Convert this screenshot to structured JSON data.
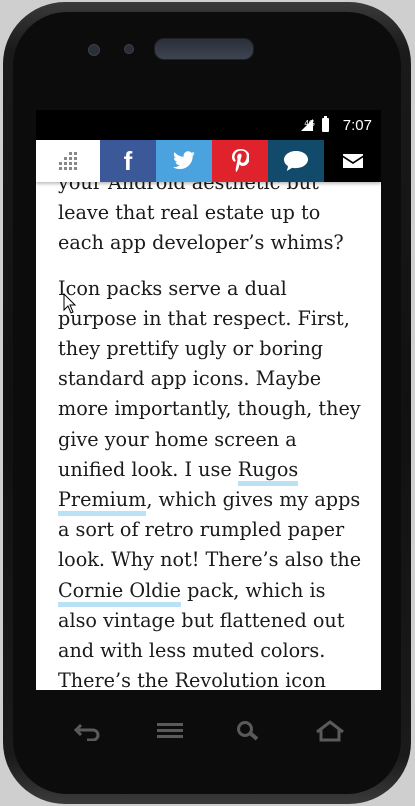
{
  "status": {
    "network": "4G",
    "time": "7:07"
  },
  "share_bar": {
    "items": [
      "apps-grid-icon",
      "facebook-icon",
      "twitter-icon",
      "pinterest-icon",
      "comment-icon",
      "mail-icon"
    ],
    "colors": {
      "facebook": "#3b5998",
      "twitter": "#4aa3df",
      "pinterest": "#e0222d",
      "comment": "#114a6b",
      "mail": "#000000"
    }
  },
  "article": {
    "p1": "your Android aesthetic but leave that real estate up to each app developer’s whims?",
    "p2_a": "Icon packs serve a dual purpose in that respect. First, they prettify ugly or boring standard app icons. Maybe more importantly, though, they give your home screen a unified look. I use ",
    "p2_link1": "Rugos Premium",
    "p2_b": ", which gives my apps a sort of retro rumpled paper look. Why not! There’s also the ",
    "p2_link2": "Cornie Oldie",
    "p2_c": " pack, which is also vintage but flattened out and with less muted colors. There’s the Revolution icon pack, for"
  },
  "nav": [
    "back-icon",
    "menu-icon",
    "search-icon",
    "home-icon"
  ]
}
